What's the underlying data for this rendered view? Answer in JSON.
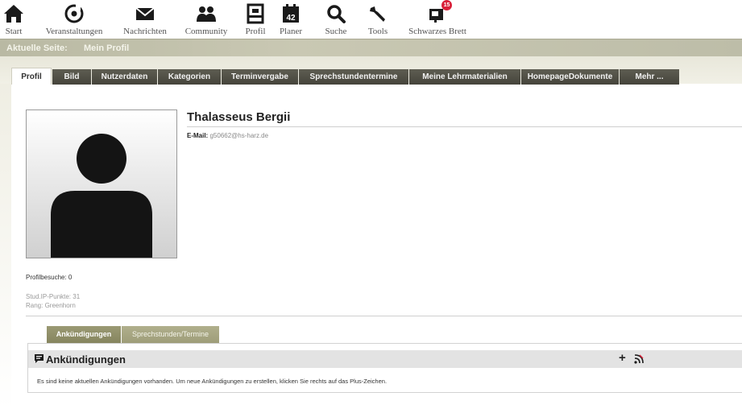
{
  "nav": {
    "items": [
      {
        "label": "Start",
        "icon": "home-icon"
      },
      {
        "label": "Veranstaltungen",
        "icon": "seminar-icon"
      },
      {
        "label": "Nachrichten",
        "icon": "mail-icon"
      },
      {
        "label": "Community",
        "icon": "community-icon"
      },
      {
        "label": "Profil",
        "icon": "profile-icon"
      },
      {
        "label": "Planer",
        "icon": "calendar-icon"
      },
      {
        "label": "Suche",
        "icon": "search-icon"
      },
      {
        "label": "Tools",
        "icon": "wrench-icon"
      },
      {
        "label": "Schwarzes Brett",
        "icon": "blackboard-icon",
        "badge": "15"
      }
    ]
  },
  "breadcrumb": {
    "prefix": "Aktuelle Seite:",
    "current": "Mein Profil"
  },
  "tabs": [
    {
      "label": "Profil",
      "active": true
    },
    {
      "label": "Bild"
    },
    {
      "label": "Nutzerdaten"
    },
    {
      "label": "Kategorien"
    },
    {
      "label": "Terminvergabe"
    },
    {
      "label": "Sprechstundentermine"
    },
    {
      "label": "Meine Lehrmaterialien"
    },
    {
      "label": "HomepageDokumente"
    },
    {
      "label": "Mehr ..."
    }
  ],
  "profile": {
    "name": "Thalasseus Bergii",
    "email_label": "E-Mail:",
    "email": "g50662@hs-harz.de",
    "visits": "Profilbesuche: 0",
    "points": "Stud.IP-Punkte: 31",
    "rank": "Rang: Greenhorn"
  },
  "subtabs": [
    {
      "label": "Ankündigungen",
      "active": true
    },
    {
      "label": "Sprechstunden/Termine"
    }
  ],
  "announcements": {
    "title": "Ankündigungen",
    "add_symbol": "+",
    "message": "Es sind keine aktuellen Ankündigungen vorhanden. Um neue Ankündigungen zu erstellen, klicken Sie rechts auf das Plus-Zeichen."
  },
  "colors": {
    "tab_dark": "#4f4e45",
    "crumb_bar": "#c3c2ac",
    "subtab_active": "#908f68",
    "badge": "#d9213a"
  }
}
